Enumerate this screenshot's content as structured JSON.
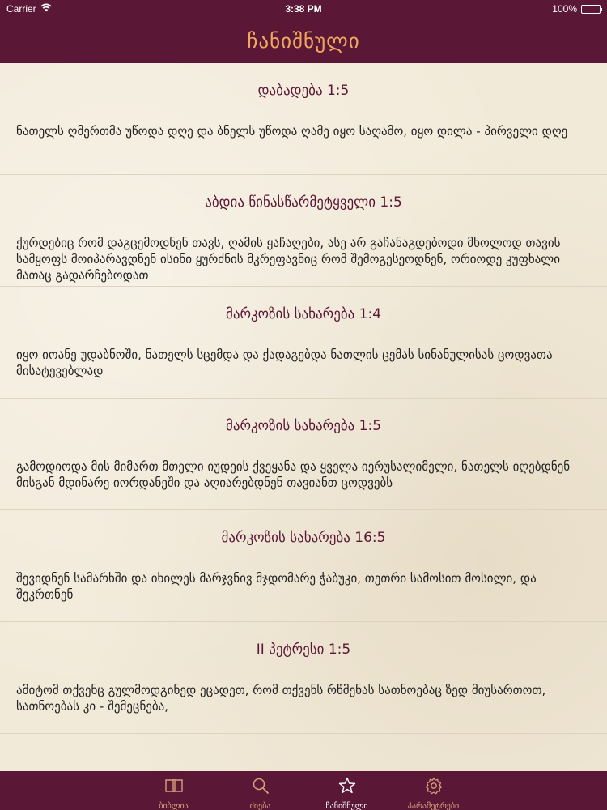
{
  "status_bar": {
    "carrier": "Carrier",
    "time": "3:38 PM",
    "battery": "100%"
  },
  "nav": {
    "title": "ჩანიშნული"
  },
  "verses": [
    {
      "reference": "დაბადება  1:5",
      "text": "  ნათელს ღმერთმა უწოდა დღე და ბნელს უწოდა ღამე იყო საღამო, იყო დილა - პირველი დღე"
    },
    {
      "reference": "აბდია წინასწარმეტყველი 1:5",
      "text": "  ქურდებიც რომ დაგცემოდნენ თავს, ღამის ყაჩაღები, ასე არ გაჩანაგდებოდი მხოლოდ თავის სამყოფს მოიპარავდნენ ისინი ყურძნის მკრეფავნიც რომ შემოგესეოდნენ, ორიოდე კუფხალი მათაც გადარჩებოდათ"
    },
    {
      "reference": "მარკოზის სახარება 1:4",
      "text": "  იყო იოანე უდაბნოში, ნათელს სცემდა და ქადაგებდა ნათლის ცემას სინანულისას ცოდვათა მისატევებლად"
    },
    {
      "reference": "მარკოზის სახარება 1:5",
      "text": "  გამოდიოდა მის მიმართ მთელი იუდეის ქვეყანა და ყველა იერუსალიმელი, ნათელს იღებდნენ მისგან მდინარე იორდანეში და აღიარებდნენ თავიანთ ცოდვებს"
    },
    {
      "reference": "მარკოზის სახარება 16:5",
      "text": "  შევიდნენ სამარხში და იხილეს მარჯვნივ მჯდომარე ჭაბუკი, თეთრი სამოსით მოსილი, და შეკრთნენ"
    },
    {
      "reference": "II პეტრესი 1:5",
      "text": "  ამიტომ თქვენც გულმოდგინედ ეცადეთ, რომ თქვენს რწმენას სათნოებაც ზედ მიუსართოთ, სათნოებას კი - შემეცნება,"
    }
  ],
  "tabs": [
    {
      "label": "ბიბლია",
      "icon": "book-icon"
    },
    {
      "label": "ძიება",
      "icon": "search-icon"
    },
    {
      "label": "ჩანიშნული",
      "icon": "star-icon",
      "active": true
    },
    {
      "label": "პარამეტრები",
      "icon": "gear-icon"
    }
  ],
  "colors": {
    "brand": "#5a1736",
    "title": "#f0a860",
    "tab_label": "#d8a07a",
    "background": "#f2ead9"
  }
}
